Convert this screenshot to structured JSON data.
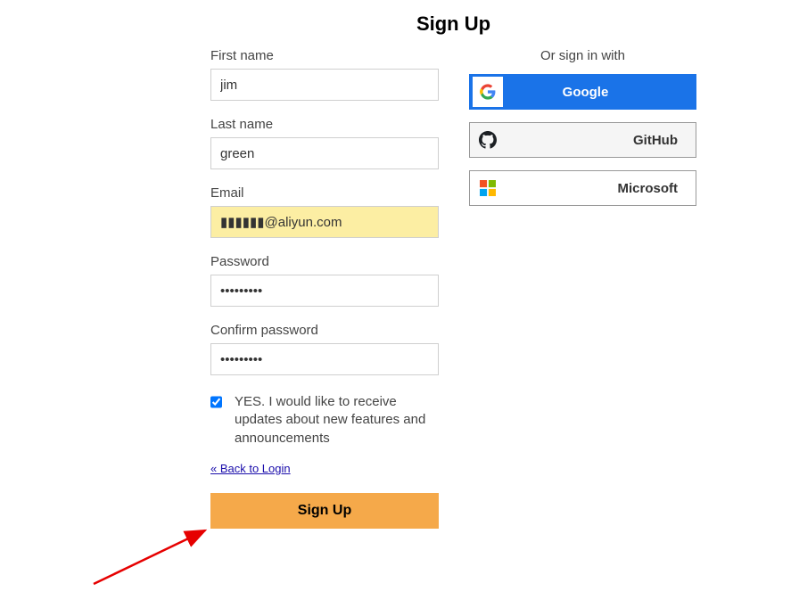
{
  "title": "Sign Up",
  "form": {
    "first_name_label": "First name",
    "first_name_value": "jim",
    "last_name_label": "Last name",
    "last_name_value": "green",
    "email_label": "Email",
    "email_value": "▮▮▮▮▮▮@aliyun.com",
    "password_label": "Password",
    "password_value": "•••••••••",
    "confirm_label": "Confirm password",
    "confirm_value": "•••••••••",
    "newsletter_checked": true,
    "newsletter_text": "YES. I would like to receive updates about new features and announcements",
    "back_link": "« Back to Login",
    "submit_label": "Sign Up"
  },
  "sso": {
    "title": "Or sign in with",
    "google": "Google",
    "github": "GitHub",
    "microsoft": "Microsoft"
  }
}
